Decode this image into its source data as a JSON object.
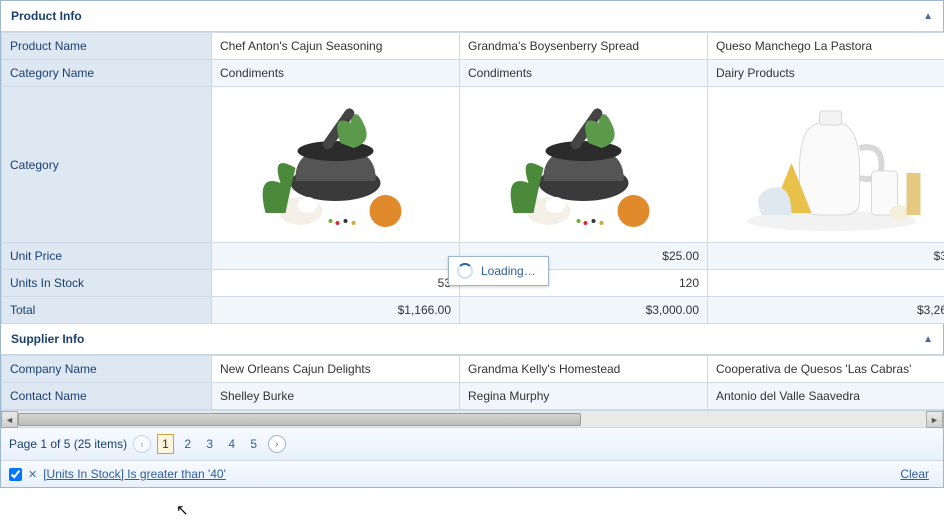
{
  "groups": {
    "product_info": "Product Info",
    "supplier_info": "Supplier Info"
  },
  "row_headers": {
    "product_name": "Product Name",
    "category_name": "Category Name",
    "category": "Category",
    "unit_price": "Unit Price",
    "units_in_stock": "Units In Stock",
    "total": "Total",
    "company_name": "Company Name",
    "contact_name": "Contact Name"
  },
  "products": [
    {
      "product_name": "Chef Anton's Cajun Seasoning",
      "category_name": "Condiments",
      "category_icon": "condiments-icon",
      "unit_price": "",
      "units_in_stock": "53",
      "total": "$1,166.00",
      "company_name": "New Orleans Cajun Delights",
      "contact_name": "Shelley Burke"
    },
    {
      "product_name": "Grandma's Boysenberry Spread",
      "category_name": "Condiments",
      "category_icon": "condiments-icon",
      "unit_price": "$25.00",
      "units_in_stock": "120",
      "total": "$3,000.00",
      "company_name": "Grandma Kelly's Homestead",
      "contact_name": "Regina Murphy"
    },
    {
      "product_name": "Queso Manchego La Pastora",
      "category_name": "Dairy Products",
      "category_icon": "dairy-icon",
      "unit_price": "$3",
      "units_in_stock": "",
      "total": "$3,26",
      "company_name": "Cooperativa de Quesos 'Las Cabras'",
      "contact_name": "Antonio del Valle Saavedra"
    }
  ],
  "pager": {
    "summary": "Page 1 of 5 (25 items)",
    "pages": [
      "1",
      "2",
      "3",
      "4",
      "5"
    ],
    "current": "1"
  },
  "filter": {
    "checked": true,
    "text": "[Units In Stock] Is greater than '40'",
    "clear": "Clear"
  },
  "loading": {
    "text": "Loading…"
  }
}
